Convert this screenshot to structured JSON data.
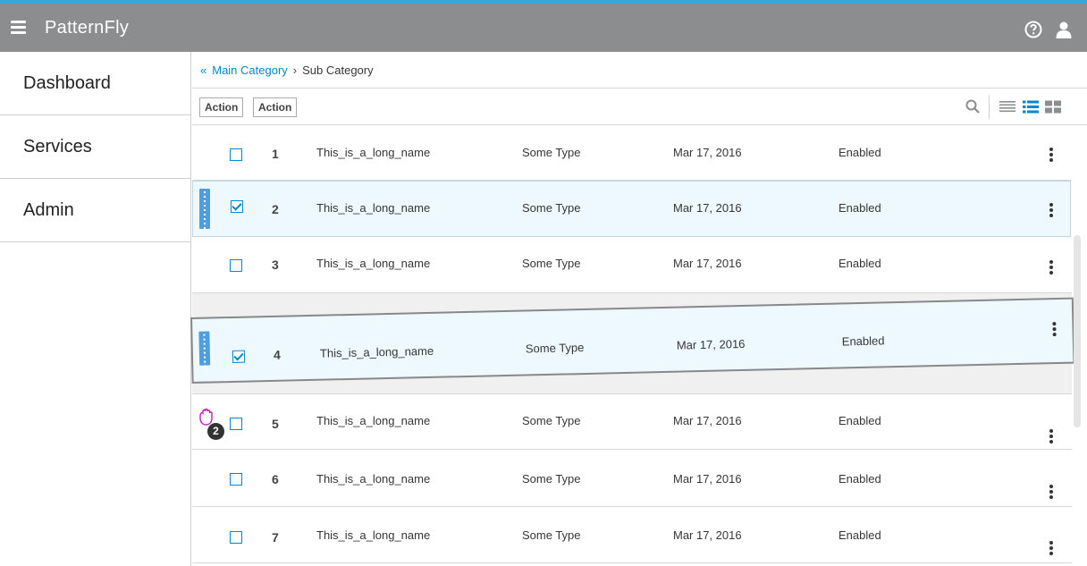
{
  "header": {
    "brand": "PatternFly",
    "icons": [
      "hamburger-icon",
      "help-icon",
      "user-icon"
    ],
    "colors": {
      "bar": "#8b8d8f",
      "accent_line": "#39a5dc"
    }
  },
  "sidebar": {
    "items": [
      {
        "label": "Dashboard"
      },
      {
        "label": "Services"
      },
      {
        "label": "Admin"
      }
    ]
  },
  "breadcrumb": {
    "main": "Main Category",
    "current": "Sub Category"
  },
  "toolbar": {
    "action1": "Action",
    "action2": "Action",
    "icons": [
      "search-icon",
      "list-view-icon",
      "card-list-view-icon",
      "grid-view-icon"
    ],
    "active_view": "card-list-view-icon"
  },
  "rows": [
    {
      "num": "1",
      "name": "This_is_a_long_name",
      "type": "Some Type",
      "date": "Mar 17, 2016",
      "status": "Enabled",
      "checked": false
    },
    {
      "num": "2",
      "name": "This_is_a_long_name",
      "type": "Some Type",
      "date": "Mar 17, 2016",
      "status": "Enabled",
      "checked": true
    },
    {
      "num": "3",
      "name": "This_is_a_long_name",
      "type": "Some Type",
      "date": "Mar 17, 2016",
      "status": "Enabled",
      "checked": false
    },
    {
      "num": "4",
      "name": "This_is_a_long_name",
      "type": "Some Type",
      "date": "Mar 17, 2016",
      "status": "Enabled",
      "checked": true
    },
    {
      "num": "5",
      "name": "This_is_a_long_name",
      "type": "Some Type",
      "date": "Mar 17, 2016",
      "status": "Enabled",
      "checked": false
    },
    {
      "num": "6",
      "name": "This_is_a_long_name",
      "type": "Some Type",
      "date": "Mar 17, 2016",
      "status": "Enabled",
      "checked": false
    },
    {
      "num": "7",
      "name": "This_is_a_long_name",
      "type": "Some Type",
      "date": "Mar 17, 2016",
      "status": "Enabled",
      "checked": false
    }
  ],
  "drag": {
    "count_badge": "2"
  }
}
